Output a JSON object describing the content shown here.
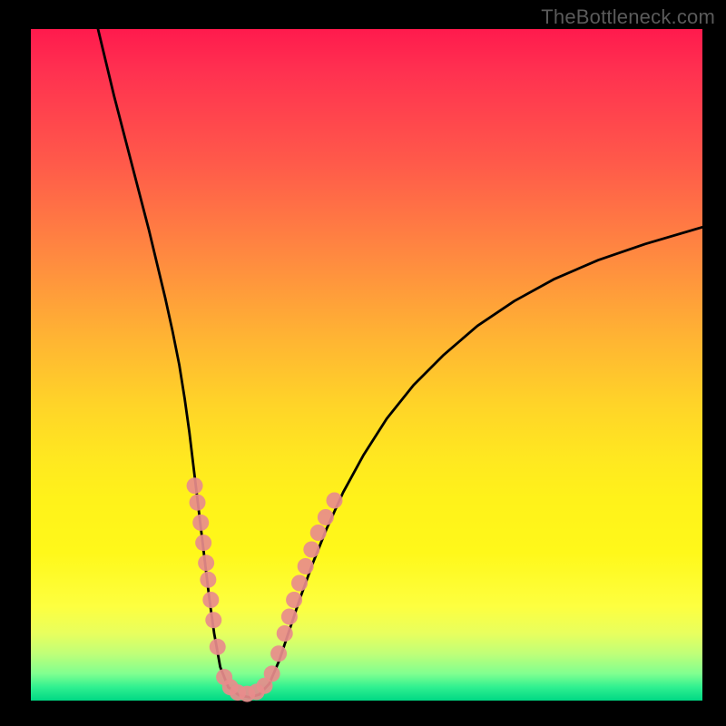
{
  "watermark": "TheBottleneck.com",
  "chart_data": {
    "type": "line",
    "title": "",
    "xlabel": "",
    "ylabel": "",
    "xlim": [
      0,
      100
    ],
    "ylim": [
      0,
      100
    ],
    "grid": false,
    "legend": false,
    "annotations": [],
    "curves": {
      "left": [
        {
          "x": 10.0,
          "y": 100.0
        },
        {
          "x": 11.2,
          "y": 95.0
        },
        {
          "x": 12.4,
          "y": 90.0
        },
        {
          "x": 13.7,
          "y": 85.0
        },
        {
          "x": 15.0,
          "y": 80.0
        },
        {
          "x": 16.3,
          "y": 75.0
        },
        {
          "x": 17.6,
          "y": 70.0
        },
        {
          "x": 18.8,
          "y": 65.0
        },
        {
          "x": 20.0,
          "y": 60.0
        },
        {
          "x": 21.1,
          "y": 55.0
        },
        {
          "x": 22.1,
          "y": 50.0
        },
        {
          "x": 22.9,
          "y": 45.0
        },
        {
          "x": 23.6,
          "y": 40.0
        },
        {
          "x": 24.2,
          "y": 35.0
        },
        {
          "x": 24.8,
          "y": 30.0
        },
        {
          "x": 25.4,
          "y": 25.0
        },
        {
          "x": 26.0,
          "y": 20.0
        },
        {
          "x": 26.6,
          "y": 15.0
        },
        {
          "x": 27.3,
          "y": 10.0
        },
        {
          "x": 28.2,
          "y": 5.0
        },
        {
          "x": 29.4,
          "y": 2.0
        },
        {
          "x": 31.0,
          "y": 0.8
        },
        {
          "x": 32.5,
          "y": 0.5
        }
      ],
      "right": [
        {
          "x": 32.5,
          "y": 0.5
        },
        {
          "x": 34.0,
          "y": 0.9
        },
        {
          "x": 35.5,
          "y": 2.5
        },
        {
          "x": 37.0,
          "y": 6.0
        },
        {
          "x": 38.5,
          "y": 10.5
        },
        {
          "x": 40.0,
          "y": 15.0
        },
        {
          "x": 42.0,
          "y": 20.5
        },
        {
          "x": 44.0,
          "y": 25.5
        },
        {
          "x": 46.5,
          "y": 31.0
        },
        {
          "x": 49.5,
          "y": 36.5
        },
        {
          "x": 53.0,
          "y": 42.0
        },
        {
          "x": 57.0,
          "y": 47.0
        },
        {
          "x": 61.5,
          "y": 51.5
        },
        {
          "x": 66.5,
          "y": 55.8
        },
        {
          "x": 72.0,
          "y": 59.5
        },
        {
          "x": 78.0,
          "y": 62.8
        },
        {
          "x": 84.5,
          "y": 65.6
        },
        {
          "x": 91.5,
          "y": 68.0
        },
        {
          "x": 100.0,
          "y": 70.5
        }
      ]
    },
    "markers": {
      "left_branch": [
        {
          "x": 24.4,
          "y": 32.0
        },
        {
          "x": 24.8,
          "y": 29.5
        },
        {
          "x": 25.3,
          "y": 26.5
        },
        {
          "x": 25.7,
          "y": 23.5
        },
        {
          "x": 26.1,
          "y": 20.5
        },
        {
          "x": 26.4,
          "y": 18.0
        },
        {
          "x": 26.8,
          "y": 15.0
        },
        {
          "x": 27.2,
          "y": 12.0
        },
        {
          "x": 27.8,
          "y": 8.0
        }
      ],
      "right_branch": [
        {
          "x": 36.9,
          "y": 7.0
        },
        {
          "x": 37.8,
          "y": 10.0
        },
        {
          "x": 38.5,
          "y": 12.5
        },
        {
          "x": 39.2,
          "y": 15.0
        },
        {
          "x": 40.0,
          "y": 17.5
        },
        {
          "x": 40.9,
          "y": 20.0
        },
        {
          "x": 41.8,
          "y": 22.5
        },
        {
          "x": 42.8,
          "y": 25.0
        },
        {
          "x": 43.9,
          "y": 27.3
        },
        {
          "x": 45.2,
          "y": 29.8
        }
      ],
      "bottom_cluster": [
        {
          "x": 28.8,
          "y": 3.5
        },
        {
          "x": 29.7,
          "y": 2.0
        },
        {
          "x": 30.8,
          "y": 1.2
        },
        {
          "x": 32.2,
          "y": 1.0
        },
        {
          "x": 33.6,
          "y": 1.3
        },
        {
          "x": 34.8,
          "y": 2.2
        },
        {
          "x": 35.9,
          "y": 4.0
        }
      ]
    },
    "marker_color": "#e88c8c",
    "marker_radius": 9,
    "line_color": "#000000",
    "line_width": 2.8
  }
}
